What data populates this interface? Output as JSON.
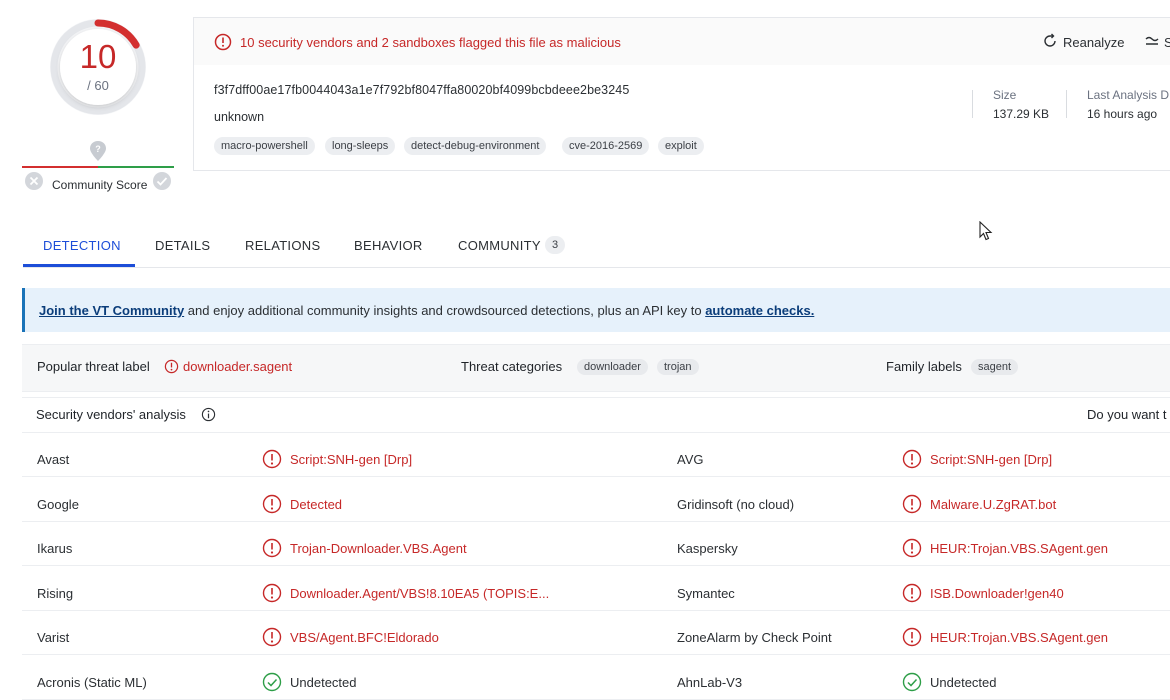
{
  "score": {
    "detections": "10",
    "total": "/ 60",
    "detection_fraction": 0.1667,
    "community_label": "Community Score"
  },
  "alert": {
    "text": "10 security vendors and 2 sandboxes flagged this file as malicious"
  },
  "actions": {
    "reanalyze": "Reanalyze",
    "similar": "S"
  },
  "file": {
    "hash": "f3f7dff00ae17fb0044043a1e7f792bf8047ffa80020bf4099bcbdeee2be3245",
    "type": "unknown",
    "tags": [
      "macro-powershell",
      "long-sleeps",
      "detect-debug-environment",
      "cve-2016-2569",
      "exploit"
    ],
    "size_label": "Size",
    "size_value": "137.29 KB",
    "last_label": "Last Analysis D",
    "last_value": "16 hours ago"
  },
  "tabs": [
    {
      "label": "DETECTION"
    },
    {
      "label": "DETAILS"
    },
    {
      "label": "RELATIONS"
    },
    {
      "label": "BEHAVIOR"
    },
    {
      "label": "COMMUNITY",
      "badge": "3"
    }
  ],
  "banner": {
    "link1": "Join the VT Community",
    "middle": " and enjoy additional community insights and crowdsourced detections, plus an API key to ",
    "link2": "automate checks."
  },
  "threat": {
    "popular_label": "Popular threat label",
    "popular_value": "downloader.sagent",
    "categories_label": "Threat categories",
    "categories": [
      "downloader",
      "trojan"
    ],
    "family_label": "Family labels",
    "family": [
      "sagent"
    ]
  },
  "vendors_header": {
    "title": "Security vendors' analysis",
    "right": "Do you want t"
  },
  "vendors": [
    {
      "left": {
        "name": "Avast",
        "result": "Script:SNH-gen [Drp]",
        "status": "malicious"
      },
      "right": {
        "name": "AVG",
        "result": "Script:SNH-gen [Drp]",
        "status": "malicious"
      }
    },
    {
      "left": {
        "name": "Google",
        "result": "Detected",
        "status": "malicious"
      },
      "right": {
        "name": "Gridinsoft (no cloud)",
        "result": "Malware.U.ZgRAT.bot",
        "status": "malicious"
      }
    },
    {
      "left": {
        "name": "Ikarus",
        "result": "Trojan-Downloader.VBS.Agent",
        "status": "malicious"
      },
      "right": {
        "name": "Kaspersky",
        "result": "HEUR:Trojan.VBS.SAgent.gen",
        "status": "malicious"
      }
    },
    {
      "left": {
        "name": "Rising",
        "result": "Downloader.Agent/VBS!8.10EA5 (TOPIS:E...",
        "status": "malicious"
      },
      "right": {
        "name": "Symantec",
        "result": "ISB.Downloader!gen40",
        "status": "malicious"
      }
    },
    {
      "left": {
        "name": "Varist",
        "result": "VBS/Agent.BFC!Eldorado",
        "status": "malicious"
      },
      "right": {
        "name": "ZoneAlarm by Check Point",
        "result": "HEUR:Trojan.VBS.SAgent.gen",
        "status": "malicious"
      }
    },
    {
      "left": {
        "name": "Acronis (Static ML)",
        "result": "Undetected",
        "status": "clean"
      },
      "right": {
        "name": "AhnLab-V3",
        "result": "Undetected",
        "status": "clean"
      }
    }
  ],
  "colors": {
    "malicious": "#c62828",
    "clean": "#2e9e48",
    "accent": "#1d4ed8",
    "banner_bg": "#e6f1fb"
  }
}
